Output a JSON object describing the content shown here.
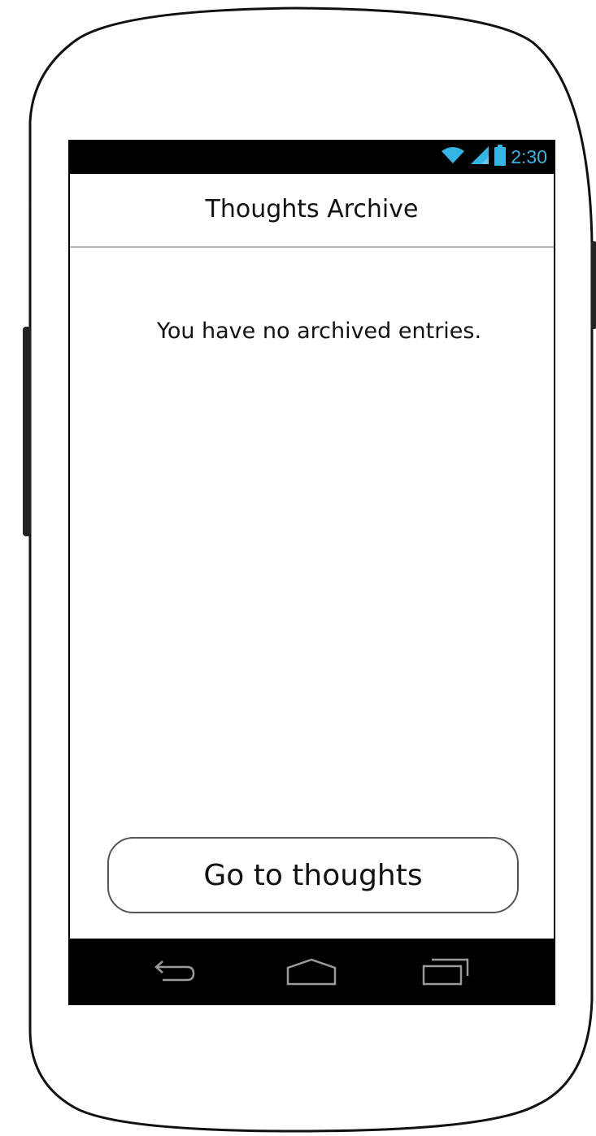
{
  "status_bar": {
    "time": "2:30",
    "icons": [
      "wifi-icon",
      "signal-icon",
      "battery-icon"
    ],
    "accent_color": "#33b5e5"
  },
  "action_bar": {
    "title": "Thoughts Archive"
  },
  "content": {
    "empty_message": "You have no archived entries."
  },
  "actions": {
    "go_button_label": "Go to thoughts"
  },
  "nav_bar": {
    "buttons": [
      "back-icon",
      "home-icon",
      "recents-icon"
    ]
  }
}
